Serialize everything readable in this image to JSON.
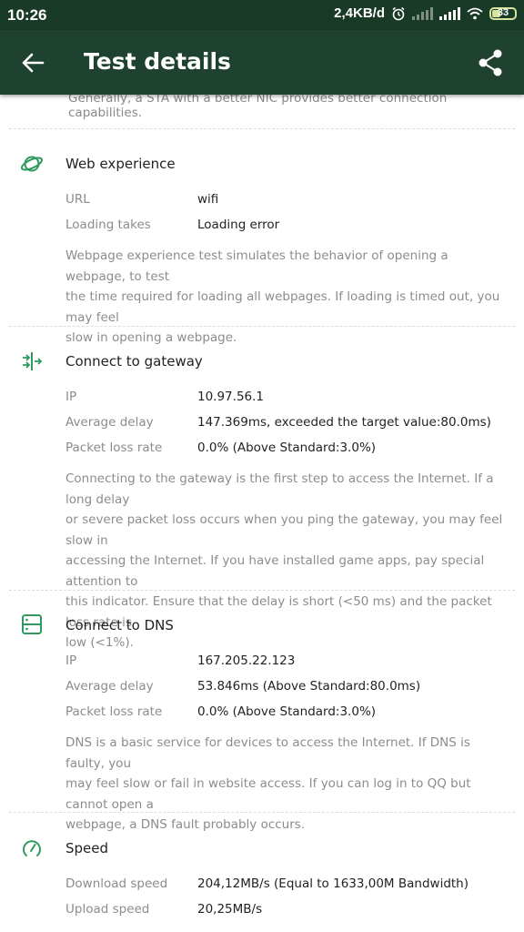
{
  "status_bar": {
    "time": "10:26",
    "net_speed": "2,4KB/d",
    "battery": "33"
  },
  "header": {
    "title": "Test details"
  },
  "intro_partial": "Generally, a STA with a better NIC provides better connection capabilities.",
  "sections": {
    "web": {
      "title": "Web experience",
      "rows": [
        {
          "label": "URL",
          "value": "wifi"
        },
        {
          "label": "Loading takes",
          "value": "Loading error"
        }
      ],
      "desc_lines": [
        "Webpage experience test simulates the behavior of opening a webpage, to test",
        "the time required for loading all webpages. If loading is timed out, you may feel",
        "slow in opening a webpage."
      ]
    },
    "gateway": {
      "title": "Connect to gateway",
      "rows": [
        {
          "label": "IP",
          "value": "10.97.56.1"
        },
        {
          "label": "Average delay",
          "value": "147.369ms, exceeded the target value:80.0ms)"
        },
        {
          "label": "Packet loss rate",
          "value": "0.0% (Above Standard:3.0%)"
        }
      ],
      "desc_lines": [
        "Connecting to the gateway is the first step to access the Internet. If a long delay",
        "or severe packet loss occurs when you ping the gateway, you may feel slow in",
        "accessing the Internet. If you have installed game apps, pay special attention to",
        "this indicator. Ensure that the delay is short (<50 ms) and the packet loss rate is",
        "low (<1%)."
      ]
    },
    "dns": {
      "title": "Connect to DNS",
      "rows": [
        {
          "label": "IP",
          "value": "167.205.22.123"
        },
        {
          "label": "Average delay",
          "value": "53.846ms (Above Standard:80.0ms)"
        },
        {
          "label": "Packet loss rate",
          "value": "0.0% (Above Standard:3.0%)"
        }
      ],
      "desc_lines": [
        "DNS is a basic service for devices to access the Internet. If DNS is faulty, you",
        "may feel slow or fail in website access. If you can log in to QQ but cannot open a",
        "webpage, a DNS fault probably occurs."
      ]
    },
    "speed": {
      "title": "Speed",
      "rows": [
        {
          "label": "Download speed",
          "value": "204,12MB/s (Equal to 1633,00M Bandwidth)"
        },
        {
          "label": "Upload speed",
          "value": "20,25MB/s"
        }
      ]
    }
  },
  "colors": {
    "statusbar": "#1a3a28",
    "appbar": "#1f4230",
    "accent": "#2e9a5e"
  }
}
